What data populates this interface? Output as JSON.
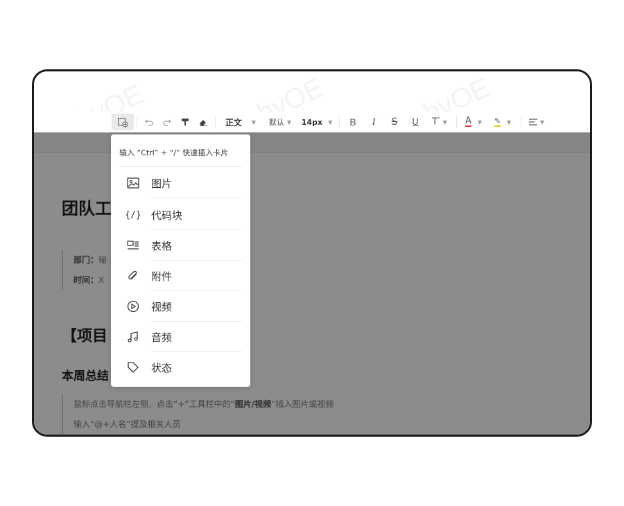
{
  "toolbar": {
    "style_select": "正文",
    "font_select": "默认",
    "size_select": "14px"
  },
  "popup": {
    "hint": "输入 “Ctrl” + “/” 快速插入卡片",
    "items": [
      {
        "label": "图片",
        "icon": "image-icon"
      },
      {
        "label": "代码块",
        "icon": "code-block-icon"
      },
      {
        "label": "表格",
        "icon": "table-icon"
      },
      {
        "label": "附件",
        "icon": "paperclip-icon"
      },
      {
        "label": "视频",
        "icon": "video-icon"
      },
      {
        "label": "音频",
        "icon": "music-icon"
      },
      {
        "label": "状态",
        "icon": "tag-icon"
      }
    ]
  },
  "document": {
    "title": "团队工",
    "meta": {
      "dept_label": "部门：",
      "dept_value": "输",
      "time_label": "时间：",
      "time_value": "X"
    },
    "section_heading": "【项目",
    "sub_heading": "本周总结",
    "hints": [
      {
        "before": "鼠标点击导航栏左侧，点击“+”工具栏中的“",
        "bold": "图片/视频",
        "after": "”插入图片或视频"
      },
      {
        "before": "输入“@+人名”提及相关人员",
        "bold": "",
        "after": ""
      }
    ]
  }
}
